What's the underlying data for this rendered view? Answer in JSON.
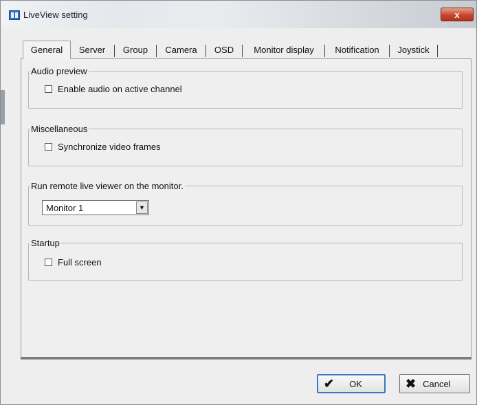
{
  "window": {
    "title": "LiveView setting",
    "close_label": "x"
  },
  "tabs": [
    {
      "label": "General",
      "active": true
    },
    {
      "label": "Server"
    },
    {
      "label": "Group"
    },
    {
      "label": "Camera"
    },
    {
      "label": "OSD"
    },
    {
      "label": "Monitor display"
    },
    {
      "label": "Notification"
    },
    {
      "label": "Joystick"
    }
  ],
  "groups": {
    "audio_preview": {
      "legend": "Audio preview",
      "checkbox_label": "Enable audio on active channel",
      "checked": false
    },
    "miscellaneous": {
      "legend": "Miscellaneous",
      "checkbox_label": "Synchronize video frames",
      "checked": false
    },
    "remote_viewer": {
      "legend": "Run remote live viewer on the monitor.",
      "selected": "Monitor 1"
    },
    "startup": {
      "legend": "Startup",
      "checkbox_label": "Full screen",
      "checked": false
    }
  },
  "buttons": {
    "ok_label": "OK",
    "ok_icon": "checkmark-icon",
    "cancel_label": "Cancel",
    "cancel_icon": "x-mark-icon"
  },
  "colors": {
    "close_button": "#c8452c",
    "default_button_border": "#3c78c0"
  }
}
